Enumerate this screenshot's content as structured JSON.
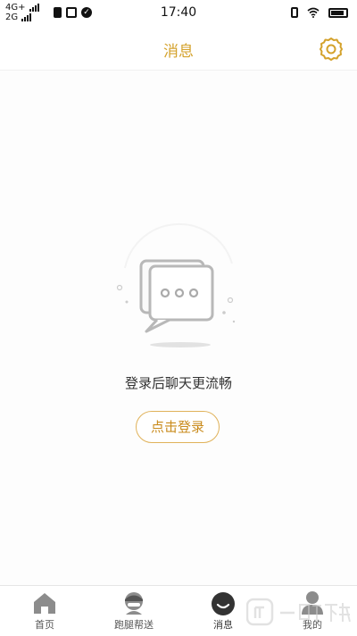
{
  "status_bar": {
    "network_top": "4G+",
    "network_bottom": "2G",
    "time": "17:40"
  },
  "header": {
    "title": "消息",
    "settings_icon": "gear-icon"
  },
  "empty_state": {
    "message": "登录后聊天更流畅",
    "illustration_icon": "chat-bubbles-icon",
    "login_button": "点击登录"
  },
  "tab_bar": {
    "items": [
      {
        "label": "首页",
        "icon": "home-icon"
      },
      {
        "label": "跑腿帮送",
        "icon": "courier-icon"
      },
      {
        "label": "消息",
        "icon": "message-icon",
        "active": true
      },
      {
        "label": "我的",
        "icon": "person-icon"
      }
    ]
  },
  "colors": {
    "accent": "#d4a22c",
    "button_border": "#e0b25a",
    "background": "#fdfdfd"
  }
}
